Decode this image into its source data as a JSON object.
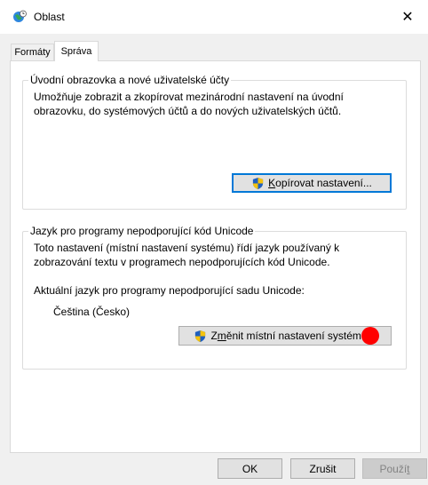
{
  "window": {
    "title": "Oblast",
    "close_glyph": "✕",
    "title_icon": "globe-clock-icon"
  },
  "tabs": [
    {
      "label": "Formáty",
      "selected": false
    },
    {
      "label": "Správa",
      "selected": true
    }
  ],
  "welcome_group": {
    "legend": "Úvodní obrazovka a nové uživatelské účty",
    "description_line1": "Umožňuje zobrazit a zkopírovat mezinárodní nastavení na úvodní",
    "description_line2": "obrazovku, do systémových účtů a do nových uživatelských účtů.",
    "button_mnemonic": "K",
    "button_rest": "opírovat nastavení...",
    "button_icon": "uac-shield-icon"
  },
  "unicode_group": {
    "legend": "Jazyk pro programy nepodporující kód Unicode",
    "description_line1": "Toto nastavení (místní nastavení systému) řídí jazyk používaný k",
    "description_line2": "zobrazování textu v programech nepodporujících kód Unicode.",
    "current_label": "Aktuální jazyk pro programy nepodporující sadu Unicode:",
    "current_value": "Čeština (Česko)",
    "button_prefix": "Z",
    "button_mnemonic": "m",
    "button_rest": "ěnit místní nastavení systému...",
    "button_icon": "uac-shield-icon"
  },
  "footer": {
    "ok_label": "OK",
    "cancel_label": "Zrušit",
    "apply_prefix": "Použí",
    "apply_mnemonic": "t"
  },
  "colors": {
    "accent": "#0078d7",
    "marker": "#ff0000"
  }
}
